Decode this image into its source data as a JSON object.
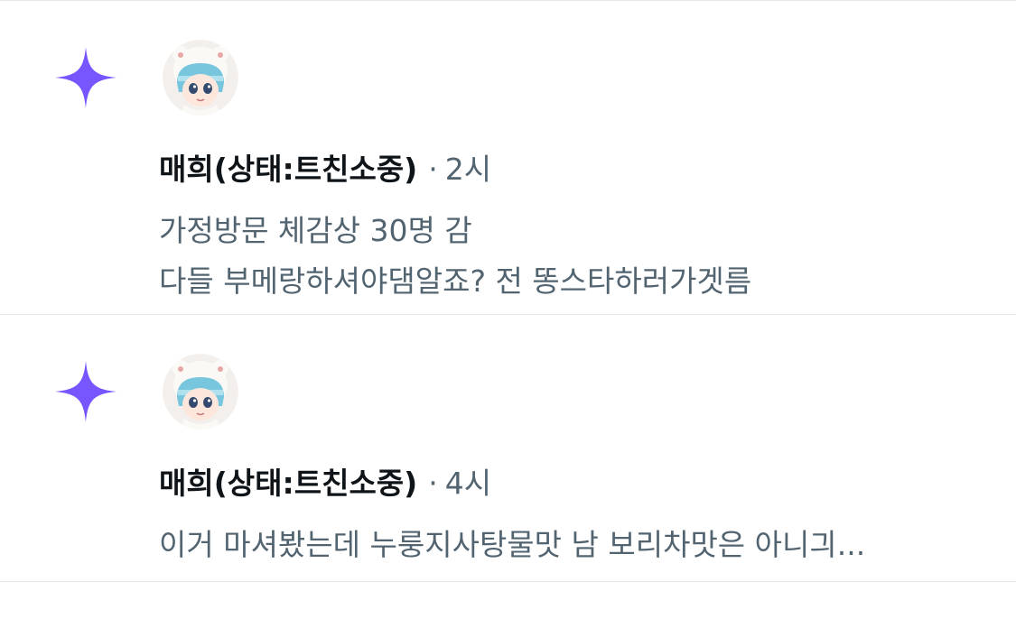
{
  "colors": {
    "accent_star": "#7856ff",
    "name": "#0f1419",
    "secondary": "#536471",
    "divider": "#e3e6e9"
  },
  "notifications": [
    {
      "icon": "sparkle-icon",
      "author": "매희(상태:트친소중)",
      "separator": "·",
      "time": "2시",
      "text": "가정방문 체감상 30명 감\n다들 부메랑하셔야댐알죠? 전 똥스타하러가겟름"
    },
    {
      "icon": "sparkle-icon",
      "author": "매희(상태:트친소중)",
      "separator": "·",
      "time": "4시",
      "text": "이거 마셔봤는데 누룽지사탕물맛 남 보리차맛은 아니긔..."
    }
  ]
}
